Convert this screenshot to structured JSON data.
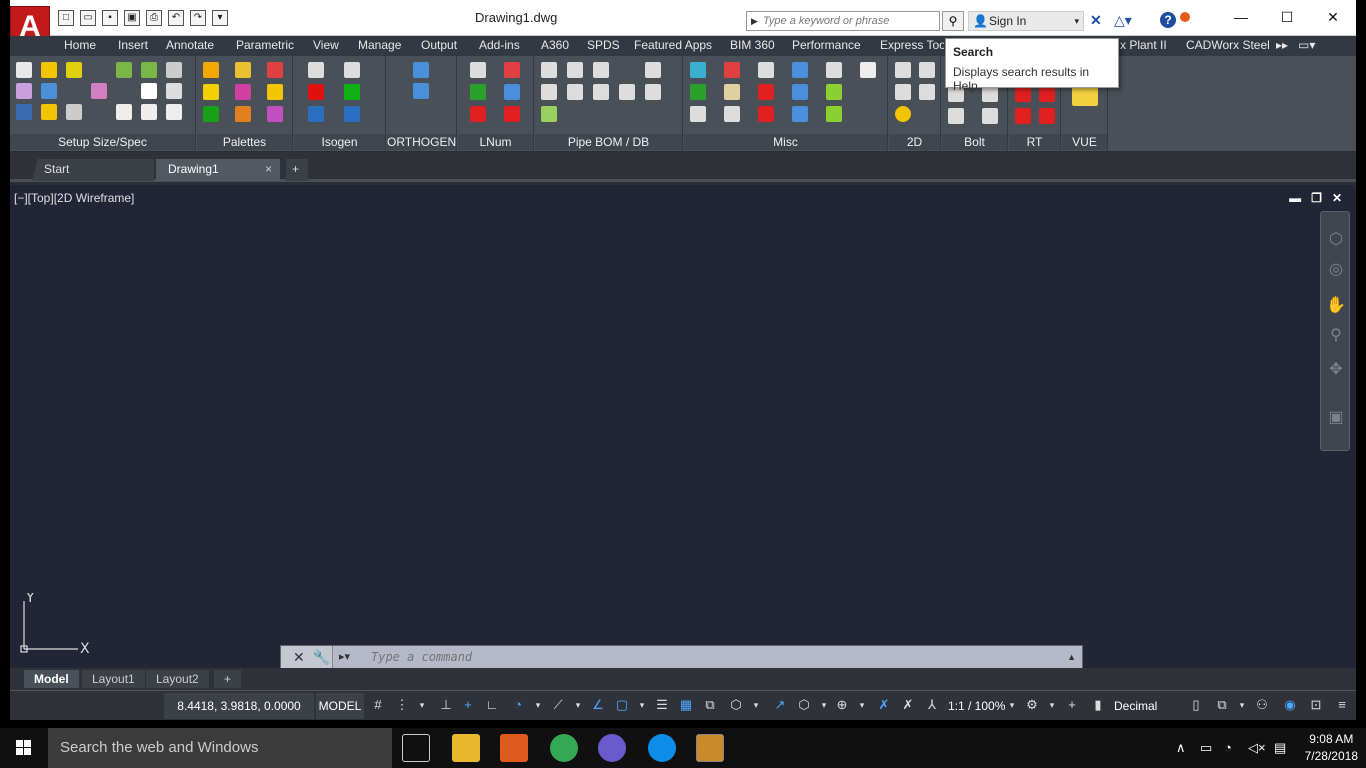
{
  "app": {
    "logo_letter": "A",
    "document_title": "Drawing1.dwg"
  },
  "search": {
    "placeholder": "Type a keyword or phrase",
    "signin_label": "Sign In"
  },
  "tooltip": {
    "title": "Search",
    "description": "Displays search results in Help."
  },
  "menu": [
    "Home",
    "Insert",
    "Annotate",
    "Parametric",
    "View",
    "Manage",
    "Output",
    "Add-ins",
    "A360",
    "SPDS",
    "Featured Apps",
    "BIM 360",
    "Performance",
    "Express Tools",
    "x Plant II",
    "CADWorx Steel"
  ],
  "ribbon": {
    "panels": [
      "Setup Size/Spec",
      "Palettes",
      "Isogen",
      "ORTHOGEN",
      "LNum",
      "Pipe BOM / DB",
      "Misc",
      "2D",
      "Bolt",
      "RT",
      "VUE"
    ]
  },
  "doc_tabs": {
    "start": "Start",
    "drawing": "Drawing1",
    "close": "×",
    "add": "+"
  },
  "viewport": {
    "label": "[−][Top][2D Wireframe]",
    "ucs_y": "Y",
    "ucs_x": "X"
  },
  "command": {
    "placeholder": "Type a command"
  },
  "layout_tabs": [
    "Model",
    "Layout1",
    "Layout2"
  ],
  "layout_add": "+",
  "status": {
    "coords": "8.4418, 3.9818, 0.0000",
    "space": "MODEL",
    "scale": "1:1 / 100%",
    "units": "Decimal"
  },
  "taskbar": {
    "search_placeholder": "Search the web and Windows",
    "time": "9:08 AM",
    "date": "7/28/2018"
  },
  "colors": {
    "autocad_red": "#c21a1a",
    "viewport_bg": "#212535",
    "ribbon_bg": "#4a5058"
  }
}
